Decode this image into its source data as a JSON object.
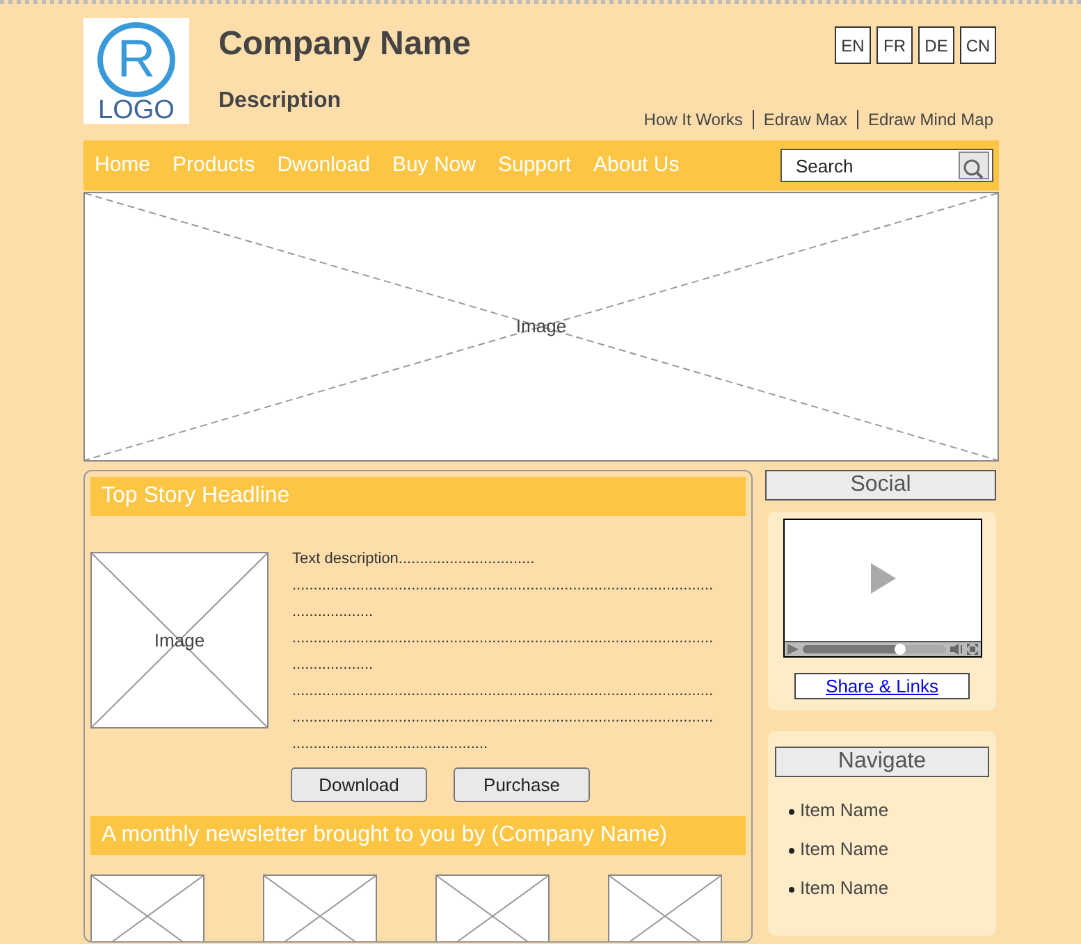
{
  "logo": {
    "letter": "R",
    "text": "LOGO"
  },
  "company_name": "Company Name",
  "description": "Description",
  "languages": [
    "EN",
    "FR",
    "DE",
    "CN"
  ],
  "top_links": [
    "How It Works",
    "Edraw Max",
    "Edraw Mind Map"
  ],
  "nav": {
    "items": [
      "Home",
      "Products",
      "Dwonload",
      "Buy Now",
      "Support",
      "About Us"
    ],
    "search": {
      "placeholder": "Search"
    }
  },
  "hero": {
    "label": "Image"
  },
  "top_story": {
    "headline": "Top Story Headline",
    "image_label": "Image",
    "text_lines": [
      "Text description................................",
      "...................................................................................................",
      "...................",
      "...................................................................................................",
      "...................",
      "...................................................................................................",
      "...................................................................................................",
      ".............................................."
    ],
    "buttons": [
      "Download",
      "Purchase"
    ]
  },
  "newsletter": {
    "title": "A monthly newsletter brought to you by (Company Name)"
  },
  "social": {
    "title": "Social",
    "video": {
      "level": 0.68
    },
    "share_link": "Share & Links"
  },
  "navigate": {
    "title": "Navigate",
    "items": [
      "Item Name",
      "Item Name",
      "Item Name"
    ]
  }
}
